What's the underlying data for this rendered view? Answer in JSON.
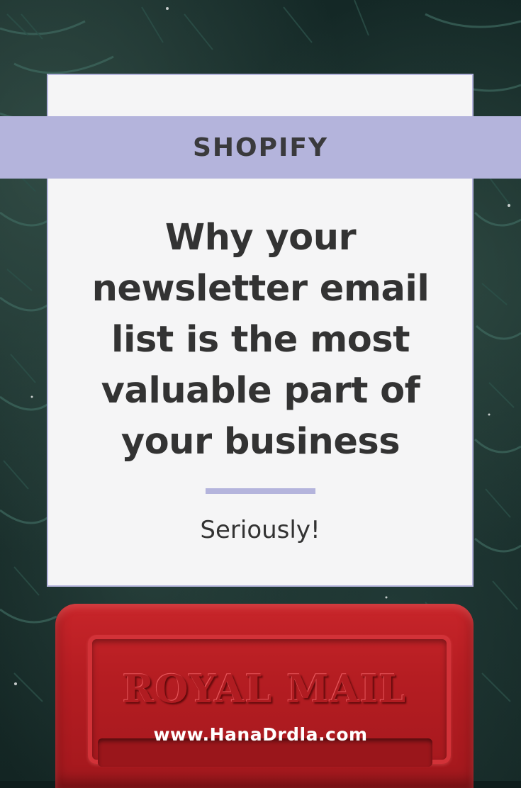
{
  "pin": {
    "category": "SHOPIFY",
    "headline": "Why your newsletter email list is the most valuable part of your business",
    "subtitle": "Seriously!",
    "website": "www.HanaDrdla.com"
  },
  "photo": {
    "postbox_lettering": "ROYAL MAIL"
  },
  "colors": {
    "accent": "#b4b4dc",
    "card_background": "#f5f5f6",
    "text": "#333333",
    "postbox_red": "#c8252a"
  }
}
